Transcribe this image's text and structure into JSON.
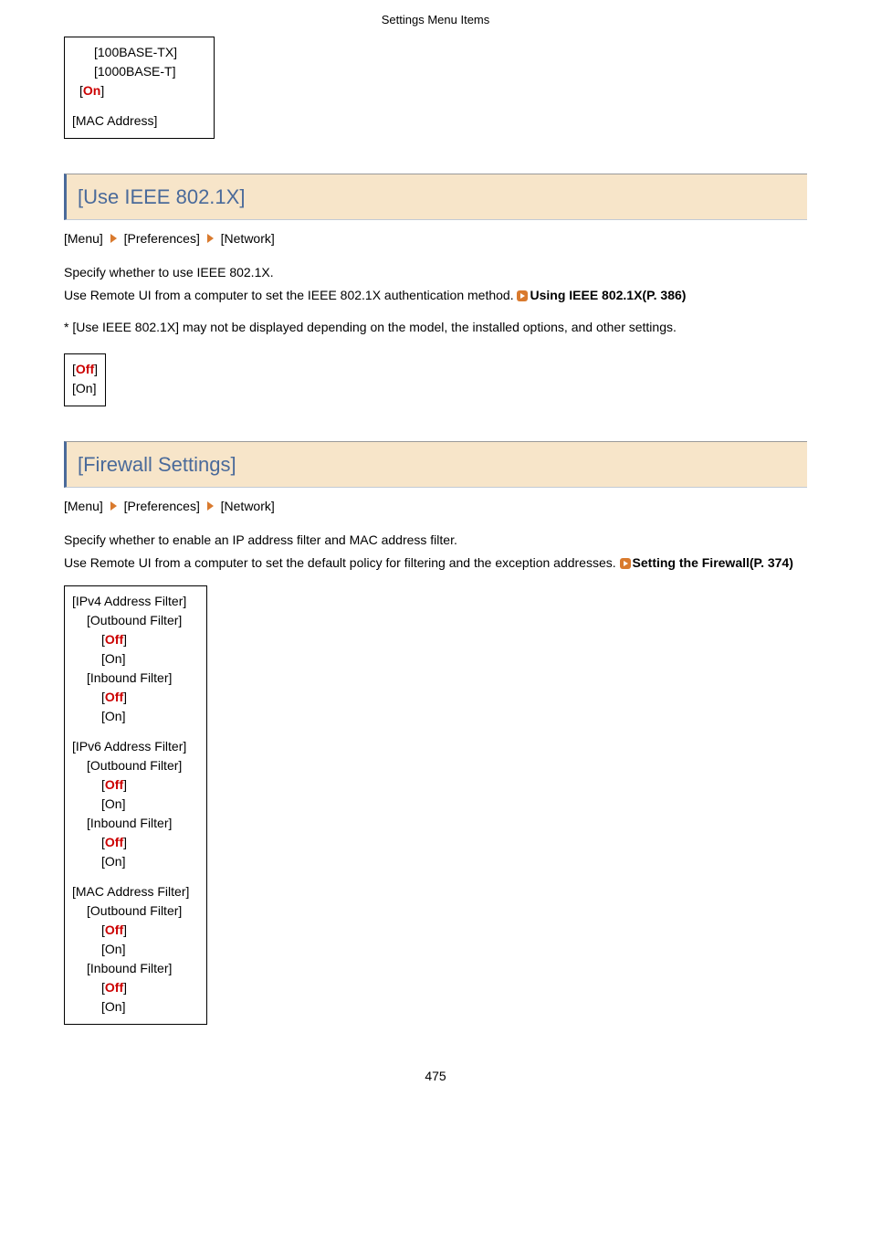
{
  "header": {
    "title": "Settings Menu Items"
  },
  "top_box": {
    "items": [
      "[100BASE-TX]",
      "[1000BASE-T]"
    ],
    "on_prefix": "[",
    "on_value": "On",
    "on_suffix": "]",
    "mac": "[MAC Address]"
  },
  "section1": {
    "heading": "[Use IEEE 802.1X]",
    "breadcrumb": [
      "[Menu]",
      "[Preferences]",
      "[Network]"
    ],
    "p1": "Specify whether to use IEEE 802.1X.",
    "p2": "Use Remote UI from a computer to set the IEEE 802.1X authentication method. ",
    "link": "Using IEEE 802.1X(P. 386)",
    "note": "* [Use IEEE 802.1X] may not be displayed depending on the model, the installed options, and other settings.",
    "box": {
      "off_prefix": "[",
      "off_value": "Off",
      "off_suffix": "]",
      "on": "[On]"
    }
  },
  "section2": {
    "heading": "[Firewall Settings]",
    "breadcrumb": [
      "[Menu]",
      "[Preferences]",
      "[Network]"
    ],
    "p1": "Specify whether to enable an IP address filter and MAC address filter.",
    "p2": "Use Remote UI from a computer to set the default policy for filtering and the exception addresses. ",
    "link": "Setting the Firewall(P. 374)",
    "groups": [
      {
        "title": "[IPv4 Address Filter]",
        "filters": [
          {
            "label": "[Outbound Filter]",
            "off_prefix": "[",
            "off_value": "Off",
            "off_suffix": "]",
            "on": "[On]"
          },
          {
            "label": "[Inbound Filter]",
            "off_prefix": "[",
            "off_value": "Off",
            "off_suffix": "]",
            "on": "[On]"
          }
        ]
      },
      {
        "title": "[IPv6 Address Filter]",
        "filters": [
          {
            "label": "[Outbound Filter]",
            "off_prefix": "[",
            "off_value": "Off",
            "off_suffix": "]",
            "on": "[On]"
          },
          {
            "label": "[Inbound Filter]",
            "off_prefix": "[",
            "off_value": "Off",
            "off_suffix": "]",
            "on": "[On]"
          }
        ]
      },
      {
        "title": "[MAC Address Filter]",
        "filters": [
          {
            "label": "[Outbound Filter]",
            "off_prefix": "[",
            "off_value": "Off",
            "off_suffix": "]",
            "on": "[On]"
          },
          {
            "label": "[Inbound Filter]",
            "off_prefix": "[",
            "off_value": "Off",
            "off_suffix": "]",
            "on": "[On]"
          }
        ]
      }
    ]
  },
  "pageNumber": "475"
}
